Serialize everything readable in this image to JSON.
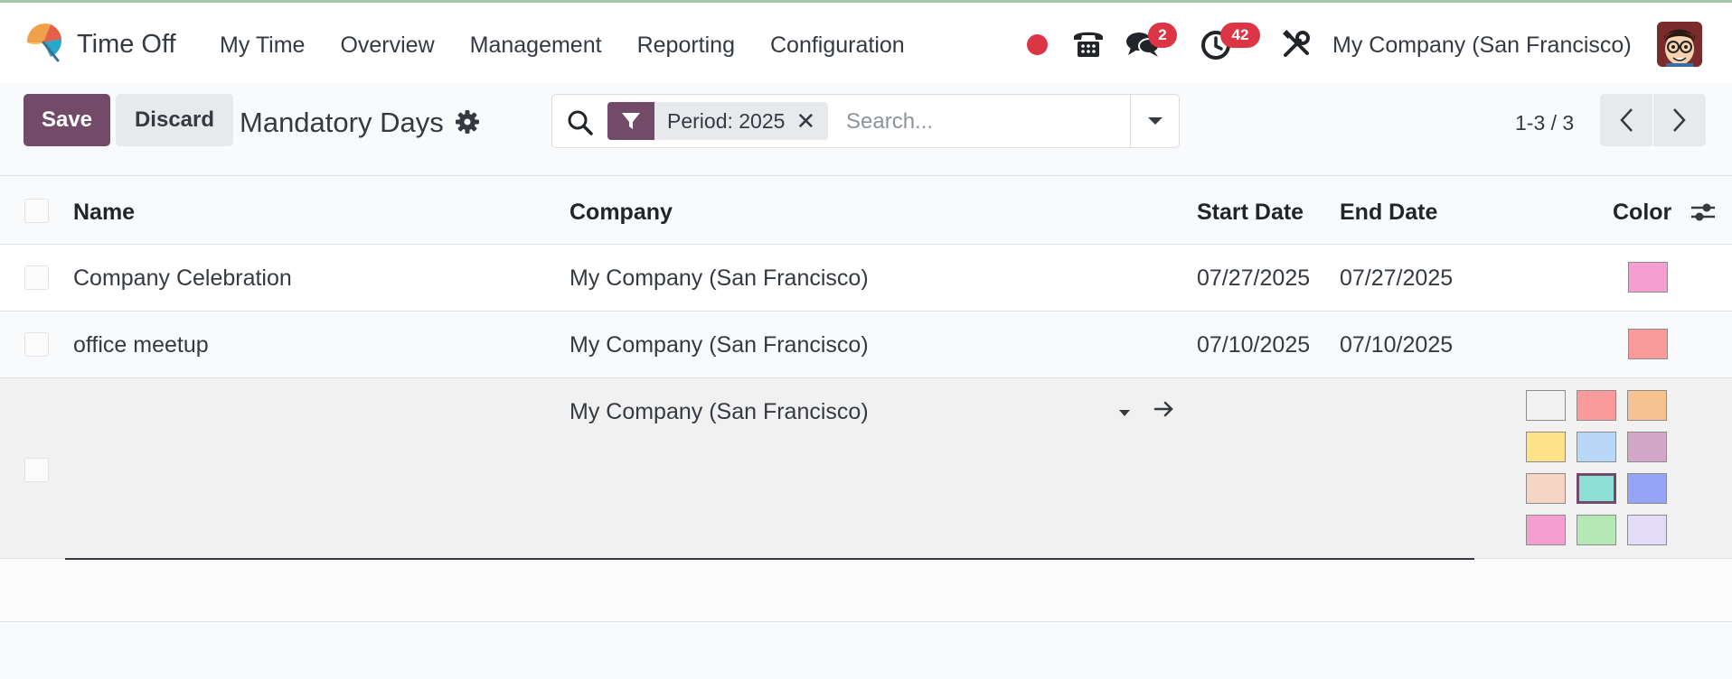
{
  "navbar": {
    "app_name": "Time Off",
    "menu": [
      "My Time",
      "Overview",
      "Management",
      "Reporting",
      "Configuration"
    ],
    "chat_count": "2",
    "activity_count": "42",
    "company": "My Company (San Francisco)",
    "icons": [
      "umbrella-icon",
      "record-dot-icon",
      "phone-icon",
      "chat-icon",
      "clock-icon",
      "tools-icon",
      "avatar"
    ]
  },
  "control": {
    "save_label": "Save",
    "discard_label": "Discard",
    "title": "Mandatory Days",
    "facet_label": "Period: 2025",
    "search_placeholder": "Search...",
    "pager": "1-3 / 3"
  },
  "table": {
    "headers": {
      "name": "Name",
      "company": "Company",
      "start": "Start Date",
      "end": "End Date",
      "color": "Color"
    },
    "rows": [
      {
        "name": "Company Celebration",
        "company": "My Company (San Francisco)",
        "start": "07/27/2025",
        "end": "07/27/2025",
        "color": "#f59fd0"
      },
      {
        "name": "office meetup",
        "company": "My Company (San Francisco)",
        "start": "07/10/2025",
        "end": "07/10/2025",
        "color": "#fb9a9a"
      }
    ],
    "editing_row": {
      "company": "My Company (San Francisco)",
      "palette": [
        "#f1f1f1",
        "#fb9a9a",
        "#f8c392",
        "#fde28a",
        "#b9d7f7",
        "#d4a7c8",
        "#f6d5c4",
        "#8ee0d6",
        "#96a4f5",
        "#f59fd0",
        "#b5e8b5",
        "#e4dbf6"
      ],
      "selected_color_index": 7
    }
  },
  "colors": {
    "brand": "#714b67",
    "badge": "#dc3545"
  }
}
